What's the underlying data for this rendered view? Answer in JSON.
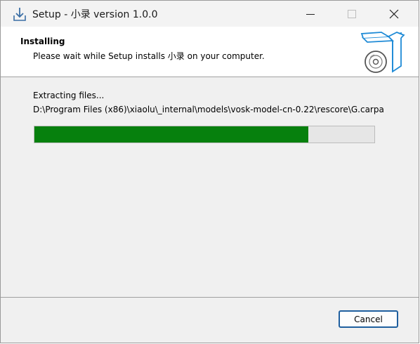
{
  "window": {
    "title": "Setup - 小录 version 1.0.0"
  },
  "header": {
    "title": "Installing",
    "subtitle": "Please wait while Setup installs 小录 on your computer."
  },
  "body": {
    "status": "Extracting files...",
    "current_file": "D:\\Program Files (x86)\\xiaolu\\_internal\\models\\vosk-model-cn-0.22\\rescore\\G.carpa",
    "progress_fraction": 0.805
  },
  "footer": {
    "cancel_label": "Cancel"
  },
  "colors": {
    "progress": "#06800d",
    "accent": "#1f5f9f"
  },
  "icons": {
    "app": "setup-download-icon",
    "logo": "cd-box-icon"
  }
}
